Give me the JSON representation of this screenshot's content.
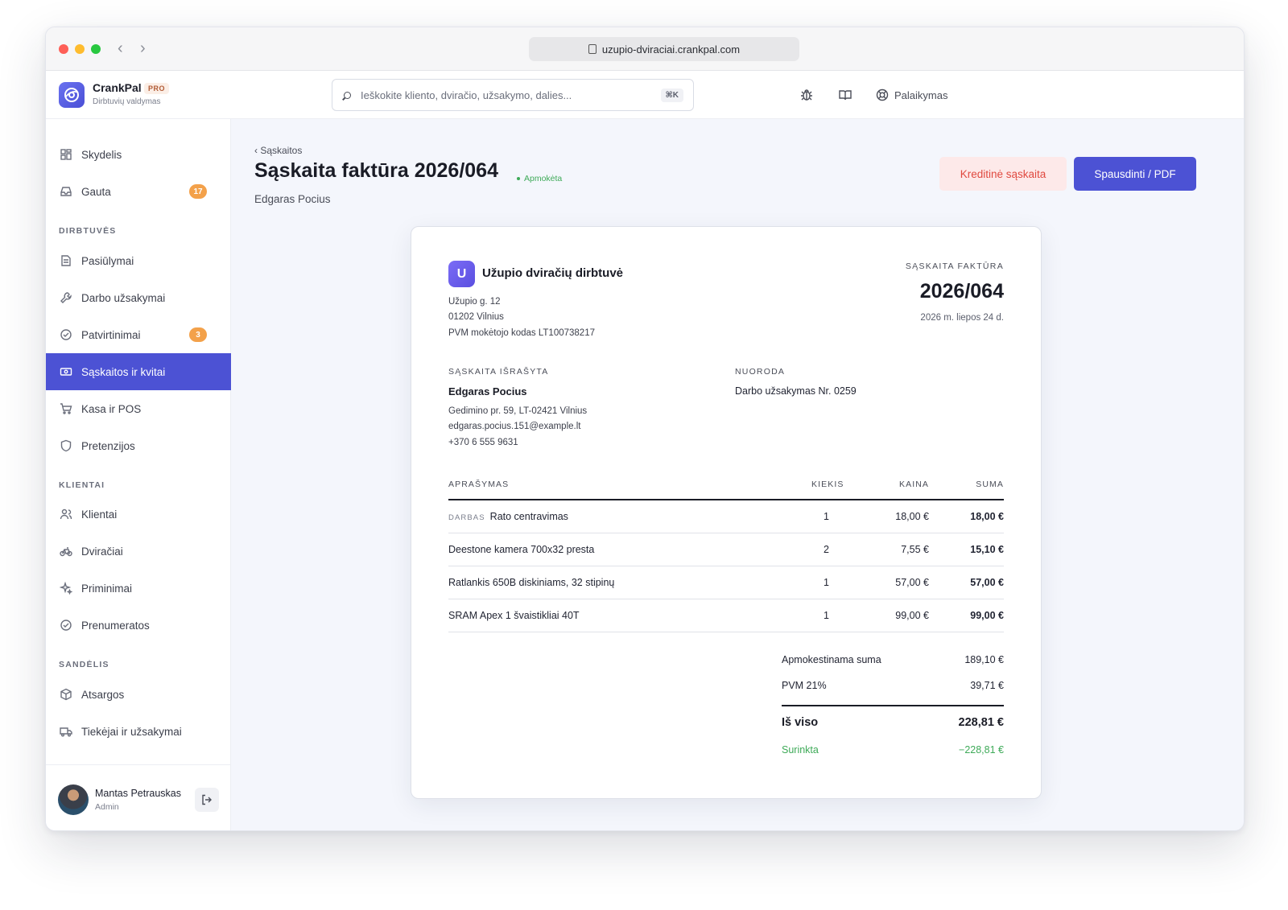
{
  "browser": {
    "url": "uzupio-dviraciai.crankpal.com"
  },
  "app": {
    "name": "CrankPal",
    "badge": "PRO",
    "subtitle": "Dirbtuvių valdymas"
  },
  "search": {
    "placeholder": "Ieškokite kliento, dviračio, užsakymo, dalies...",
    "shortcut": "⌘K"
  },
  "topnav": {
    "support_label": "Palaikymas"
  },
  "sidebar": {
    "items": [
      {
        "label": "Skydelis"
      },
      {
        "label": "Gauta",
        "badge": "17"
      }
    ],
    "sections": [
      {
        "title": "DIRBTUVĖS",
        "items": [
          {
            "label": "Pasiūlymai"
          },
          {
            "label": "Darbo užsakymai"
          },
          {
            "label": "Patvirtinimai",
            "badge": "3"
          },
          {
            "label": "Sąskaitos ir kvitai",
            "active": true
          },
          {
            "label": "Kasa ir POS"
          },
          {
            "label": "Pretenzijos"
          }
        ]
      },
      {
        "title": "KLIENTAI",
        "items": [
          {
            "label": "Klientai"
          },
          {
            "label": "Dviračiai"
          },
          {
            "label": "Priminimai"
          },
          {
            "label": "Prenumeratos"
          }
        ]
      },
      {
        "title": "SANDĖLIS",
        "items": [
          {
            "label": "Atsargos"
          },
          {
            "label": "Tiekėjai ir užsakymai"
          }
        ]
      }
    ],
    "user": {
      "name": "Mantas Petrauskas",
      "role": "Admin"
    }
  },
  "page": {
    "breadcrumb": "‹ Sąskaitos",
    "title": "Sąskaita faktūra 2026/064",
    "status": "Apmokėta",
    "customer": "Edgaras Pocius",
    "credit_button": "Kreditinė sąskaita",
    "print_button": "Spausdinti / PDF"
  },
  "invoice": {
    "company": {
      "initial": "U",
      "name": "Užupio dviračių dirbtuvė",
      "address_lines": [
        "Užupio g. 12",
        "01202 Vilnius",
        "PVM mokėtojo kodas LT100738217"
      ]
    },
    "doc_label": "SĄSKAITA FAKTŪRA",
    "number": "2026/064",
    "date": "2026 m. liepos 24 d.",
    "bill_to_label": "SĄSKAITA IŠRAŠYTA",
    "bill_to": {
      "name": "Edgaras Pocius",
      "lines": [
        "Gedimino pr. 59, LT-02421 Vilnius",
        "edgaras.pocius.151@example.lt",
        "+370 6 555 9631"
      ]
    },
    "reference_label": "NUORODA",
    "reference": "Darbo užsakymas Nr. 0259",
    "columns": {
      "description": "APRAŠYMAS",
      "qty": "KIEKIS",
      "price": "KAINA",
      "total": "SUMA"
    },
    "lines": [
      {
        "tag": "DARBAS",
        "description": "Rato centravimas",
        "qty": "1",
        "price": "18,00 €",
        "total": "18,00 €"
      },
      {
        "tag": "",
        "description": "Deestone kamera 700x32 presta",
        "qty": "2",
        "price": "7,55 €",
        "total": "15,10 €"
      },
      {
        "tag": "",
        "description": "Ratlankis 650B diskiniams, 32 stipinų",
        "qty": "1",
        "price": "57,00 €",
        "total": "57,00 €"
      },
      {
        "tag": "",
        "description": "SRAM Apex 1 švaistikliai 40T",
        "qty": "1",
        "price": "99,00 €",
        "total": "99,00 €"
      }
    ],
    "totals": {
      "taxable_label": "Apmokestinama suma",
      "taxable": "189,10 €",
      "vat_label": "PVM 21%",
      "vat": "39,71 €",
      "grand_label": "Iš viso",
      "grand": "228,81 €",
      "collected_label": "Surinkta",
      "collected": "−228,81 €"
    }
  },
  "colors": {
    "accent": "#4c52d4",
    "badge": "#f3a14a",
    "success": "#3eaa58",
    "danger": "#e0493f"
  }
}
